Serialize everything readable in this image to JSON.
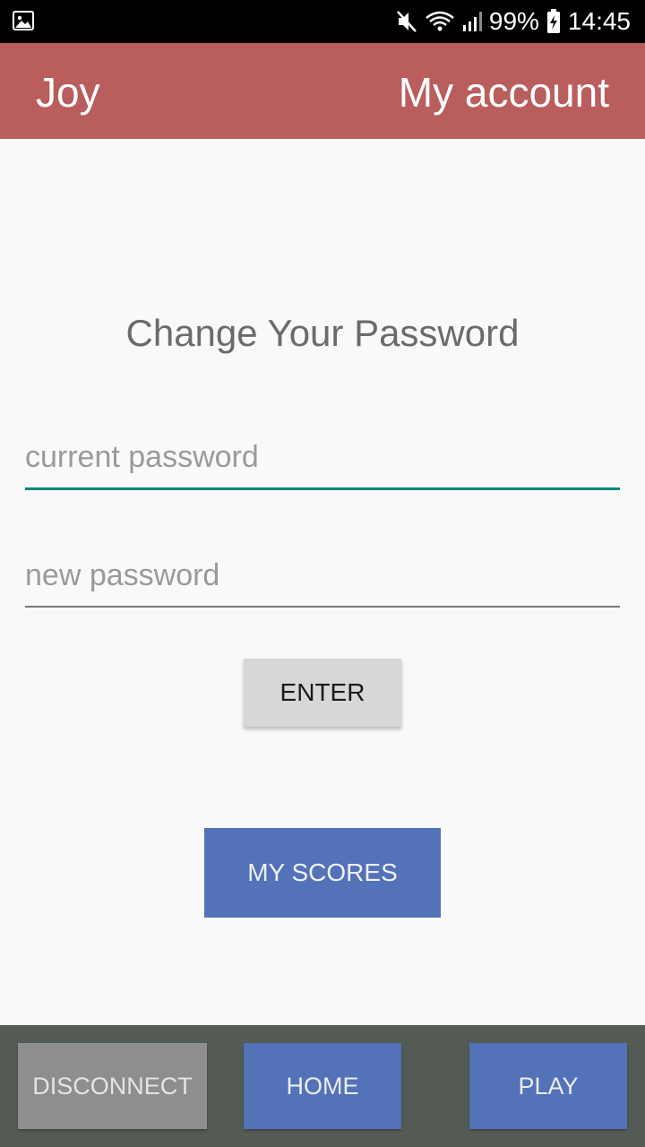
{
  "status_bar": {
    "battery": "99%",
    "time": "14:45",
    "icons": [
      "gallery-icon",
      "mute-icon",
      "wifi-icon",
      "signal-icon",
      "battery-charging-icon"
    ]
  },
  "app_bar": {
    "title": "Joy",
    "account_label": "My account",
    "color": "#b95d5d"
  },
  "form": {
    "heading": "Change Your Password",
    "current_placeholder": "current password",
    "new_placeholder": "new password",
    "enter_label": "ENTER"
  },
  "scores_label": "MY SCORES",
  "bottom_nav": {
    "disconnect_label": "DISCONNECT",
    "home_label": "HOME",
    "play_label": "PLAY"
  }
}
